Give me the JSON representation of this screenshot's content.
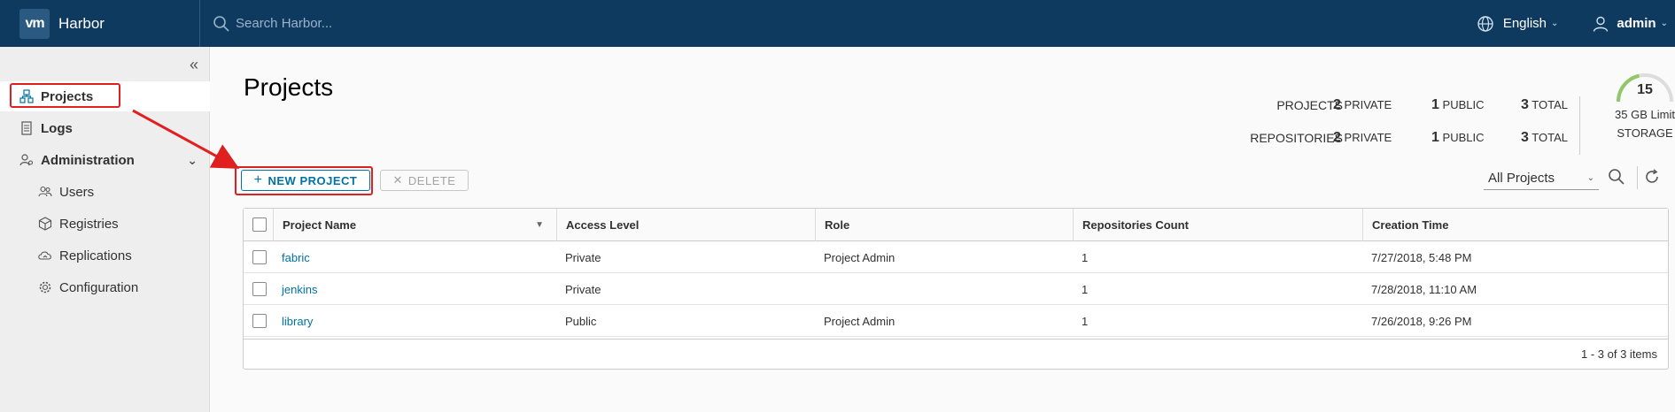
{
  "header": {
    "logo_text": "vm",
    "brand": "Harbor",
    "search_placeholder": "Search Harbor...",
    "language": "English",
    "user": "admin"
  },
  "sidebar": {
    "items": [
      {
        "label": "Projects",
        "icon": "projects-icon"
      },
      {
        "label": "Logs",
        "icon": "logs-icon"
      },
      {
        "label": "Administration",
        "icon": "administration-icon"
      },
      {
        "label": "Users",
        "icon": "users-icon"
      },
      {
        "label": "Registries",
        "icon": "registries-icon"
      },
      {
        "label": "Replications",
        "icon": "replications-icon"
      },
      {
        "label": "Configuration",
        "icon": "gear-icon"
      }
    ]
  },
  "main": {
    "title": "Projects",
    "summary": {
      "projects_label": "PROJECTS",
      "repositories_label": "REPOSITORIES",
      "private_label": "PRIVATE",
      "public_label": "PUBLIC",
      "total_label": "TOTAL",
      "projects": {
        "private": "2",
        "public": "1",
        "total": "3"
      },
      "repositories": {
        "private": "2",
        "public": "1",
        "total": "3"
      }
    },
    "storage": {
      "value": "15",
      "limit": "35 GB Limit",
      "label": "STORAGE",
      "used_fraction": 0.43
    },
    "new_project_label": "NEW PROJECT",
    "delete_label": "DELETE",
    "filter_value": "All Projects",
    "columns": [
      "Project Name",
      "Access Level",
      "Role",
      "Repositories Count",
      "Creation Time"
    ],
    "rows": [
      {
        "name": "fabric",
        "access": "Private",
        "role": "Project Admin",
        "repos": "1",
        "created": "7/27/2018, 5:48 PM"
      },
      {
        "name": "jenkins",
        "access": "Private",
        "role": "",
        "repos": "1",
        "created": "7/28/2018, 11:10 AM"
      },
      {
        "name": "library",
        "access": "Public",
        "role": "Project Admin",
        "repos": "1",
        "created": "7/26/2018, 9:26 PM"
      }
    ],
    "pagination": "1 - 3 of 3 items"
  },
  "colors": {
    "header": "#0f3a5f",
    "accent": "#0072a3",
    "annotation": "#e02020",
    "gauge": "#8fc76a"
  }
}
